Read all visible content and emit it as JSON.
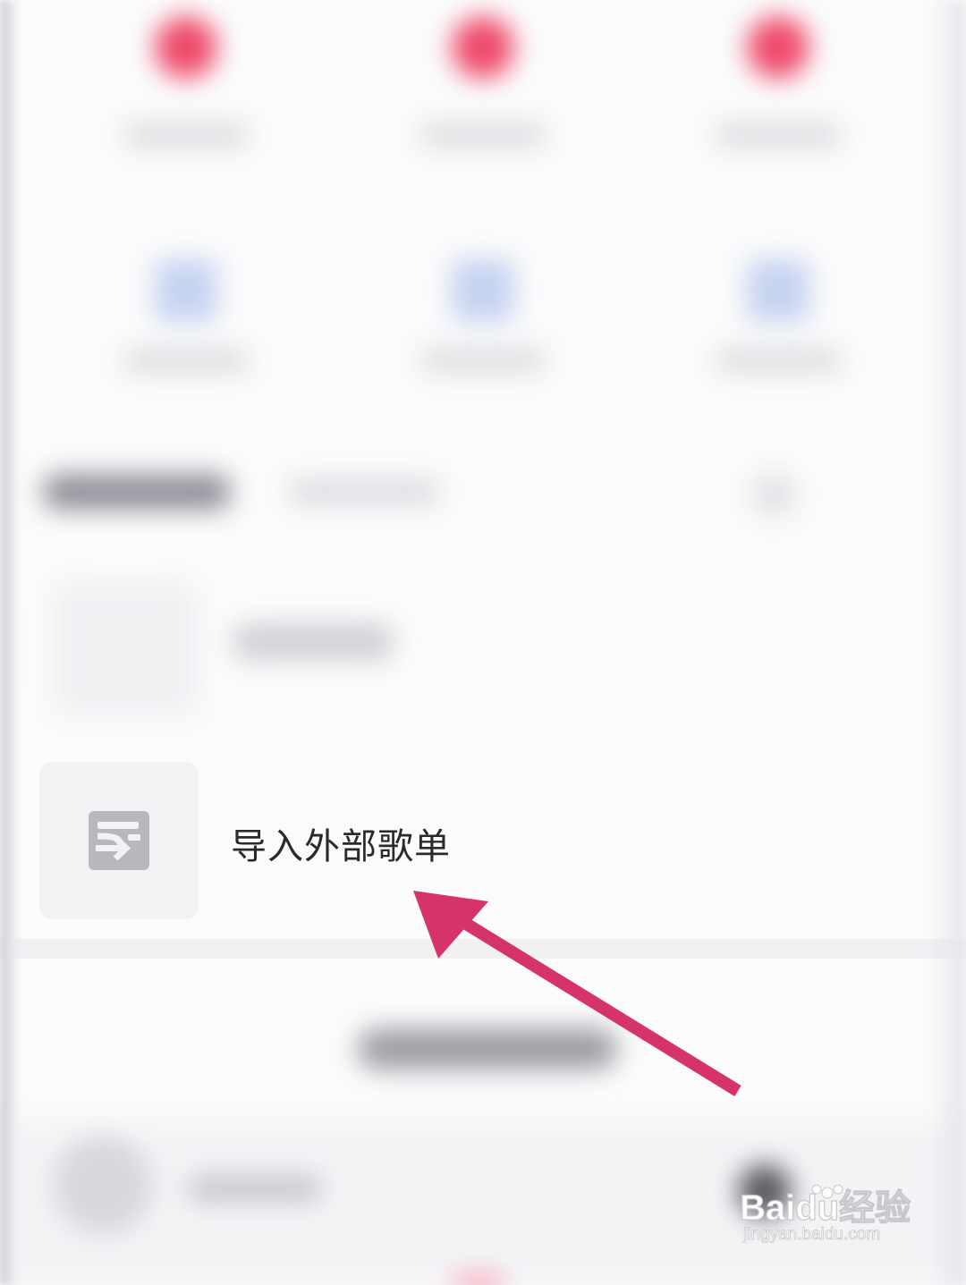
{
  "import_playlist": {
    "label": "导入外部歌单",
    "icon": "import-playlist-icon"
  },
  "watermark": {
    "brand": "Baidu经验",
    "url": "jingyan.baidu.com"
  },
  "colors": {
    "accent_pink": "#d6336c",
    "grid_icon_red": "#ee4a6a",
    "grid_icon_blue": "#6f8fd8",
    "import_icon_gray": "#b7b7be"
  }
}
